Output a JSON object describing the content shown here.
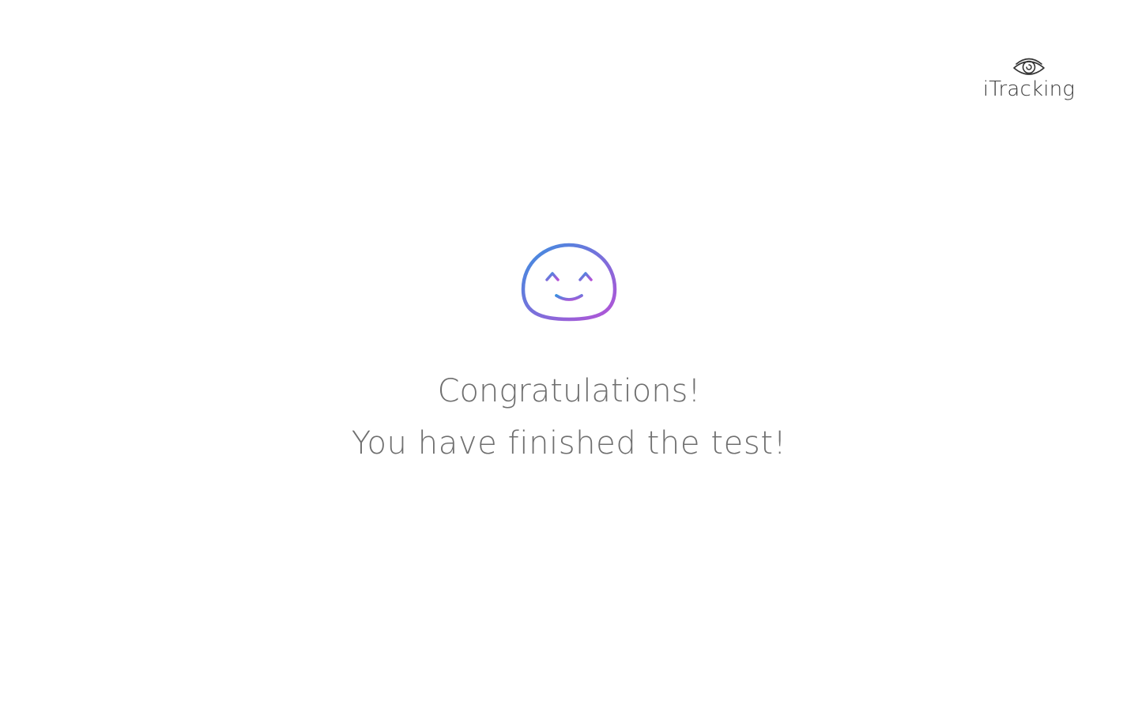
{
  "brand": {
    "name": "iTracking",
    "icon": "eye-icon",
    "color": "#333333"
  },
  "result": {
    "icon": "smiley-face-icon",
    "gradient_start": "#3b8fe0",
    "gradient_end": "#b552d6",
    "title": "Congratulations!",
    "subtitle": "You have finished the test!"
  },
  "theme": {
    "background": "#ffffff",
    "text_color": "#6f6f6f"
  }
}
